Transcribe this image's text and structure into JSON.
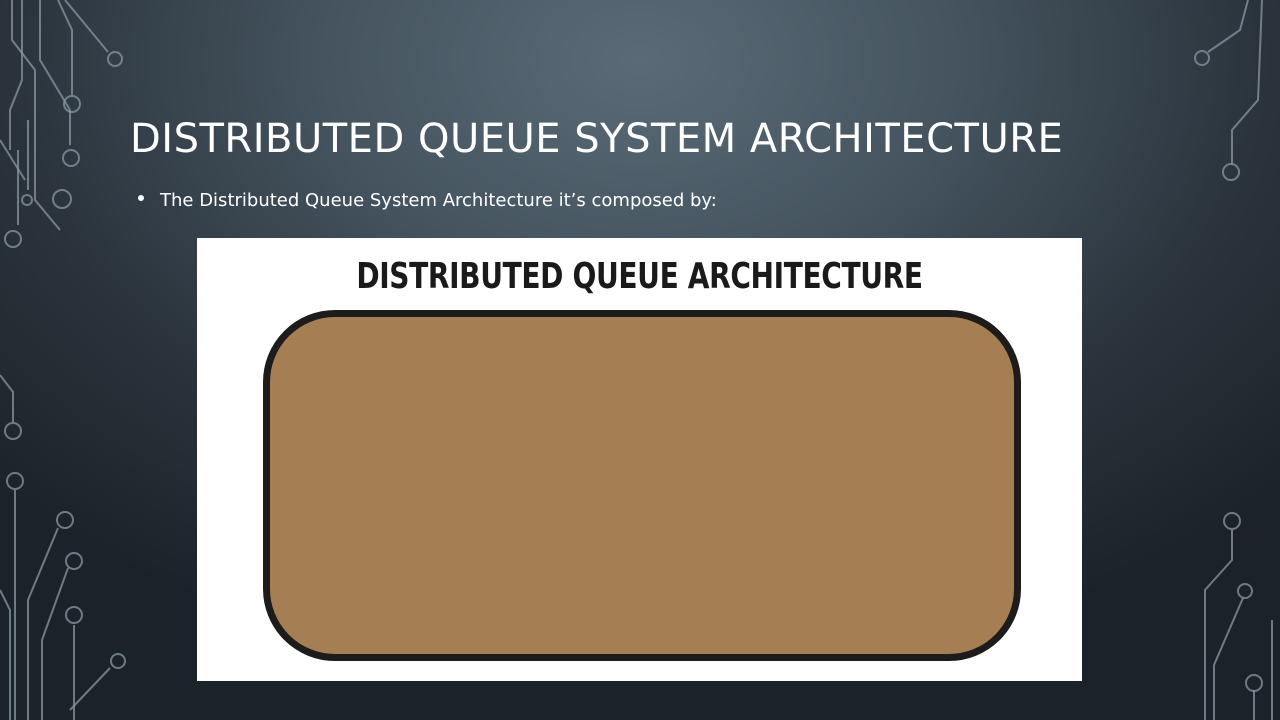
{
  "slide": {
    "title": "DISTRIBUTED QUEUE SYSTEM ARCHITECTURE",
    "bullets": [
      "The Distributed Queue System Architecture it’s composed by:"
    ]
  },
  "figure": {
    "title": "DISTRIBUTED QUEUE ARCHITECTURE",
    "box_color": "#a67e54",
    "border_color": "#1e1c1a",
    "background_color": "#ffffff"
  },
  "theme": {
    "background_center": "#5a6b77",
    "background_edge": "#1c2229",
    "circuit_color": "#8a98a3",
    "text_color": "#ffffff"
  },
  "decorations": {
    "left_icon": "circuit-traces-icon",
    "right_icon": "circuit-traces-icon"
  }
}
